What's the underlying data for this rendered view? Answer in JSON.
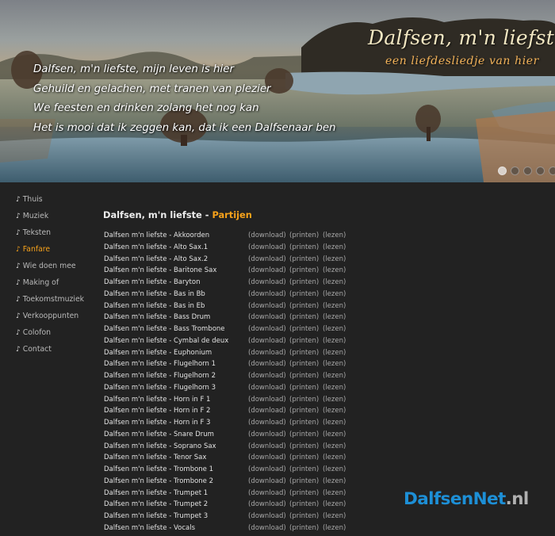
{
  "banner": {
    "lyrics": [
      "Dalfsen, m'n liefste, mijn leven is hier",
      "Gehuild en gelachen, met tranen van plezier",
      "We feesten en drinken zolang het nog kan",
      "Het is mooi dat ik zeggen kan, dat ik een Dalfsenaar ben"
    ],
    "title": "Dalfsen, m'n liefste",
    "subtitle": "een liefdesliedje van hier"
  },
  "nav": {
    "bullet": "♪",
    "items": [
      "Thuis",
      "Muziek",
      "Teksten",
      "Fanfare",
      "Wie doen mee",
      "Making of",
      "Toekomstmuziek",
      "Verkooppunten",
      "Colofon",
      "Contact"
    ],
    "active": "Fanfare"
  },
  "main": {
    "title": "Dalfsen, m'n liefste - ",
    "title_sub": "Partijen",
    "links": {
      "download": "(download)",
      "print": "(printen)",
      "read": "(lezen)"
    },
    "parts": [
      "Dalfsen m'n liefste - Akkoorden",
      "Dalfsen m'n liefste - Alto Sax.1",
      "Dalfsen m'n liefste - Alto Sax.2",
      "Dalfsen m'n liefste - Baritone Sax",
      "Dalfsen m'n liefste - Baryton",
      "Dalfsen m'n liefste - Bas in Bb",
      "Dalfsen m'n liefste - Bas in Eb",
      "Dalfsen m'n liefste - Bass Drum",
      "Dalfsen m'n liefste - Bass Trombone",
      "Dalfsen m'n liefste - Cymbal de deux",
      "Dalfsen m'n liefste - Euphonium",
      "Dalfsen m'n liefste - Flugelhorn 1",
      "Dalfsen m'n liefste - Flugelhorn 2",
      "Dalfsen m'n liefste - Flugelhorn 3",
      "Dalfsen m'n liefste - Horn in F 1",
      "Dalfsen m'n liefste - Horn in F 2",
      "Dalfsen m'n liefste - Horn in F 3",
      "Dalfsen m'n liefste - Snare Drum",
      "Dalfsen m'n liefste - Soprano Sax",
      "Dalfsen m'n liefste - Tenor Sax",
      "Dalfsen m'n liefste - Trombone 1",
      "Dalfsen m'n liefste - Trombone 2",
      "Dalfsen m'n liefste - Trumpet 1",
      "Dalfsen m'n liefste - Trumpet 2",
      "Dalfsen m'n liefste - Trumpet 3",
      "Dalfsen m'n liefste - Vocals"
    ]
  },
  "brand": {
    "part1": "DalfsenNet",
    "part2": ".nl"
  },
  "colors": {
    "accent": "#f7a21b",
    "background": "#222222",
    "brand_blue": "#1d8fd6"
  }
}
